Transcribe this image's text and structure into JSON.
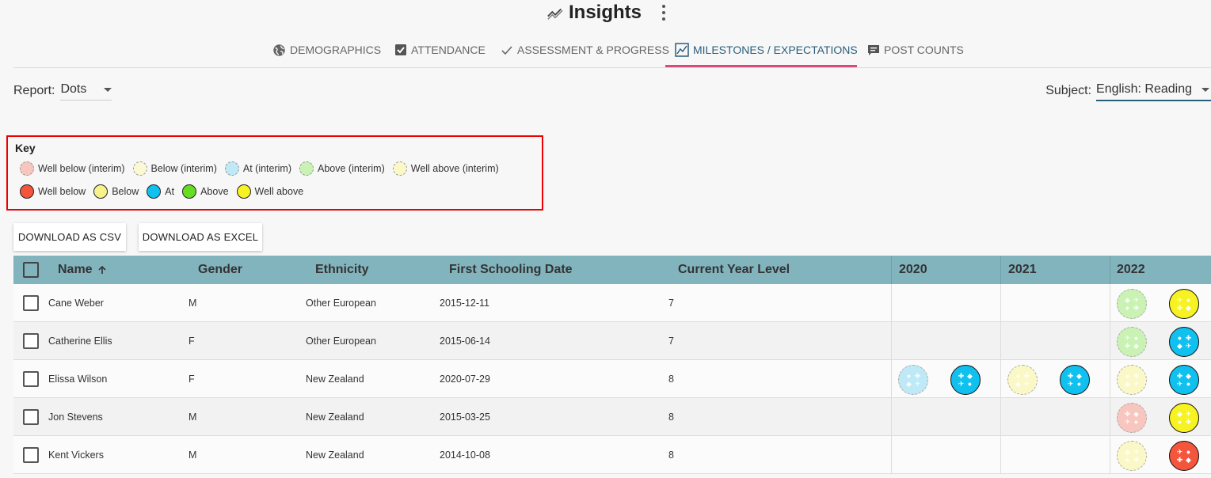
{
  "header": {
    "title": "Insights",
    "title_icon": "trending-icon",
    "menu_icon": "more-vert-icon"
  },
  "tabs": [
    {
      "label": "DEMOGRAPHICS",
      "icon": "globe-icon",
      "active": false
    },
    {
      "label": "ATTENDANCE",
      "icon": "checkbox-icon",
      "active": false
    },
    {
      "label": "ASSESSMENT & PROGRESS",
      "icon": "check-icon",
      "active": false
    },
    {
      "label": "MILESTONES / EXPECTATIONS",
      "icon": "chart-icon",
      "active": true
    },
    {
      "label": "POST COUNTS",
      "icon": "comment-icon",
      "active": false
    }
  ],
  "report": {
    "label": "Report:",
    "value": "Dots"
  },
  "subject": {
    "label": "Subject:",
    "value": "English: Reading"
  },
  "key": {
    "title": "Key",
    "interim": [
      {
        "label": "Well below (interim)",
        "color": "#f7c6bf"
      },
      {
        "label": "Below (interim)",
        "color": "#fbf8d6"
      },
      {
        "label": "At (interim)",
        "color": "#bfe9f6"
      },
      {
        "label": "Above (interim)",
        "color": "#c9f2b4"
      },
      {
        "label": "Well above (interim)",
        "color": "#fbf8c8"
      }
    ],
    "final": [
      {
        "label": "Well below",
        "color": "#f4553c"
      },
      {
        "label": "Below",
        "color": "#f8f28c"
      },
      {
        "label": "At",
        "color": "#10c0ef"
      },
      {
        "label": "Above",
        "color": "#66dd22"
      },
      {
        "label": "Well above",
        "color": "#f7f222"
      }
    ]
  },
  "buttons": {
    "csv": "DOWNLOAD AS CSV",
    "excel": "DOWNLOAD AS EXCEL"
  },
  "table": {
    "columns": {
      "name": "Name",
      "sort_icon": "arrow-up-icon",
      "gender": "Gender",
      "ethnicity": "Ethnicity",
      "first_schooling": "First Schooling Date",
      "year_level": "Current Year Level",
      "y2020": "2020",
      "y2021": "2021",
      "y2022": "2022"
    },
    "rows": [
      {
        "name": "Cane Weber",
        "gender": "M",
        "ethnicity": "Other European",
        "date": "2015-12-11",
        "year": "7",
        "y2020": [],
        "y2021": [],
        "y2022": [
          "above-interim",
          "well-above"
        ]
      },
      {
        "name": "Catherine Ellis",
        "gender": "F",
        "ethnicity": "Other European",
        "date": "2015-06-14",
        "year": "7",
        "y2020": [],
        "y2021": [],
        "y2022": [
          "above-interim",
          "at"
        ]
      },
      {
        "name": "Elissa Wilson",
        "gender": "F",
        "ethnicity": "New Zealand",
        "date": "2020-07-29",
        "year": "8",
        "y2020": [
          "at-interim",
          "at"
        ],
        "y2021": [
          "well-above-interim",
          "at"
        ],
        "y2022": [
          "well-above-interim",
          "at"
        ]
      },
      {
        "name": "Jon Stevens",
        "gender": "M",
        "ethnicity": "New Zealand",
        "date": "2015-03-25",
        "year": "8",
        "y2020": [],
        "y2021": [],
        "y2022": [
          "well-below-interim",
          "well-above"
        ]
      },
      {
        "name": "Kent Vickers",
        "gender": "M",
        "ethnicity": "New Zealand",
        "date": "2014-10-08",
        "year": "8",
        "y2020": [],
        "y2021": [],
        "y2022": [
          "well-above-interim",
          "well-below"
        ]
      }
    ]
  }
}
